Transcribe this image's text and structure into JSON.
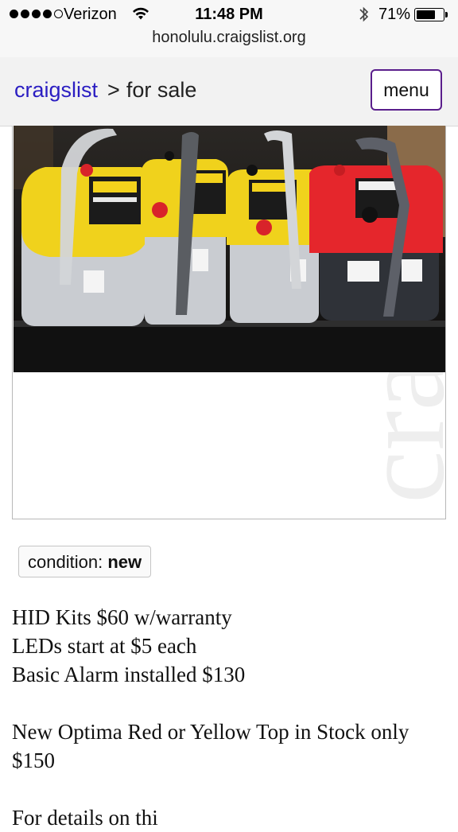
{
  "status_bar": {
    "carrier": "Verizon",
    "time": "11:48 PM",
    "battery_percent": "71%",
    "battery_level": 0.71,
    "url": "honolulu.craigslist.org"
  },
  "nav": {
    "home": "craigslist",
    "separator": ">",
    "category": "for sale",
    "menu_label": "menu"
  },
  "attributes": {
    "condition_label": "condition:",
    "condition_value": "new"
  },
  "body": {
    "lines": [
      "HID Kits $60 w/warranty",
      "LEDs start at $5 each",
      "Basic Alarm installed $130",
      "New Optima Red or Yellow Top in Stock only",
      "$150",
      "For details on thi"
    ]
  },
  "colors": {
    "link": "#2b1ec2",
    "menu_border": "#5a1e8c",
    "battery_yellow": "#f5dc1a",
    "battery_red": "#e8282c"
  }
}
